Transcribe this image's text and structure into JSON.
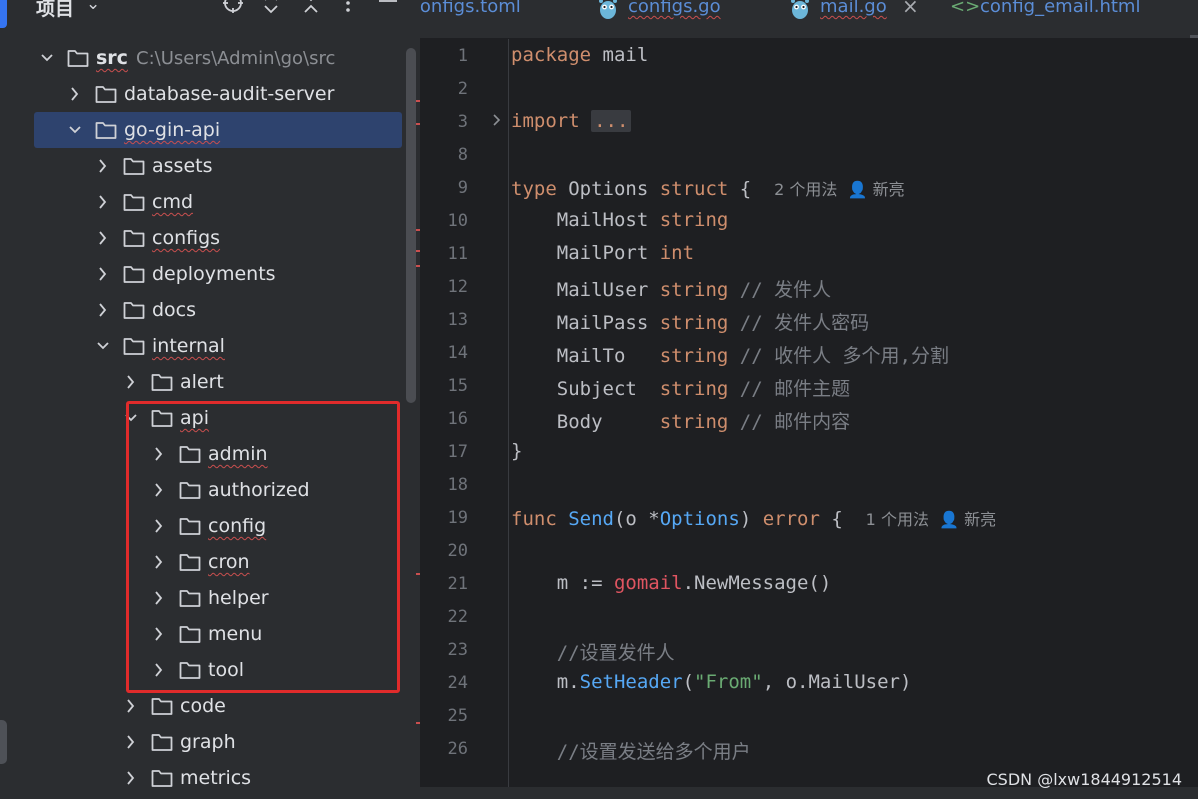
{
  "project_panel": {
    "title": "项目",
    "header_icons": [
      "locate-icon",
      "expand-all-icon",
      "collapse-all-icon",
      "more-icon",
      "minimize-icon"
    ]
  },
  "tree": {
    "rows": [
      {
        "label": "src",
        "path": "C:\\Users\\Admin\\go\\src",
        "expanded": true,
        "bold": true,
        "squiggly": true
      },
      {
        "label": "database-audit-server",
        "expanded": false
      },
      {
        "label": "go-gin-api",
        "expanded": true,
        "selected": true,
        "squiggly": true
      },
      {
        "label": "assets",
        "expanded": false
      },
      {
        "label": "cmd",
        "expanded": false,
        "squiggly": true
      },
      {
        "label": "configs",
        "expanded": false,
        "squiggly": true
      },
      {
        "label": "deployments",
        "expanded": false
      },
      {
        "label": "docs",
        "expanded": false
      },
      {
        "label": "internal",
        "expanded": true,
        "squiggly": true
      },
      {
        "label": "alert",
        "expanded": false
      },
      {
        "label": "api",
        "expanded": true,
        "squiggly": true
      },
      {
        "label": "admin",
        "expanded": false,
        "squiggly": true
      },
      {
        "label": "authorized",
        "expanded": false
      },
      {
        "label": "config",
        "expanded": false,
        "squiggly": true
      },
      {
        "label": "cron",
        "expanded": false,
        "squiggly": true
      },
      {
        "label": "helper",
        "expanded": false
      },
      {
        "label": "menu",
        "expanded": false
      },
      {
        "label": "tool",
        "expanded": false
      },
      {
        "label": "code",
        "expanded": false
      },
      {
        "label": "graph",
        "expanded": false
      },
      {
        "label": "metrics",
        "expanded": false
      }
    ]
  },
  "tabs": [
    {
      "label": "configs.toml",
      "icon": "toml-file-icon"
    },
    {
      "label": "configs.go",
      "icon": "gopher-icon",
      "squiggly": true
    },
    {
      "label": "mail.go",
      "icon": "gopher-icon",
      "active": true,
      "squiggly": true,
      "close": "×"
    },
    {
      "label": "config_email.html",
      "icon": "html-file-icon",
      "glyph": "<>"
    }
  ],
  "editor": {
    "lines": [
      {
        "n": "1",
        "tokens": [
          {
            "t": "package ",
            "c": "kw"
          },
          {
            "t": "mail",
            "c": "ident"
          }
        ]
      },
      {
        "n": "2",
        "tokens": []
      },
      {
        "n": "3",
        "fold": true,
        "tokens": [
          {
            "t": "import ",
            "c": "kw"
          },
          {
            "t": "...",
            "c": "fold-pill"
          }
        ]
      },
      {
        "n": "8",
        "tokens": []
      },
      {
        "n": "9",
        "tokens": [
          {
            "t": "type ",
            "c": "kw"
          },
          {
            "t": "Options ",
            "c": "ident"
          },
          {
            "t": "struct",
            "c": "kw"
          },
          {
            "t": " {  ",
            "c": "ident"
          },
          {
            "t": "2 个用法  ",
            "c": "hint"
          },
          {
            "t": "👤 新亮",
            "c": "hint"
          }
        ]
      },
      {
        "n": "10",
        "tokens": [
          {
            "t": "    MailHost ",
            "c": "ident"
          },
          {
            "t": "string",
            "c": "ty"
          }
        ]
      },
      {
        "n": "11",
        "tokens": [
          {
            "t": "    MailPort ",
            "c": "ident"
          },
          {
            "t": "int",
            "c": "ty"
          }
        ]
      },
      {
        "n": "12",
        "tokens": [
          {
            "t": "    MailUser ",
            "c": "ident"
          },
          {
            "t": "string",
            "c": "ty"
          },
          {
            "t": " // 发件人",
            "c": "cm"
          }
        ]
      },
      {
        "n": "13",
        "tokens": [
          {
            "t": "    MailPass ",
            "c": "ident"
          },
          {
            "t": "string",
            "c": "ty"
          },
          {
            "t": " // 发件人密码",
            "c": "cm"
          }
        ]
      },
      {
        "n": "14",
        "tokens": [
          {
            "t": "    MailTo   ",
            "c": "ident"
          },
          {
            "t": "string",
            "c": "ty"
          },
          {
            "t": " // 收件人 多个用,分割",
            "c": "cm"
          }
        ]
      },
      {
        "n": "15",
        "tokens": [
          {
            "t": "    Subject  ",
            "c": "ident"
          },
          {
            "t": "string",
            "c": "ty"
          },
          {
            "t": " // 邮件主题",
            "c": "cm"
          }
        ]
      },
      {
        "n": "16",
        "tokens": [
          {
            "t": "    Body     ",
            "c": "ident"
          },
          {
            "t": "string",
            "c": "ty"
          },
          {
            "t": " // 邮件内容",
            "c": "cm"
          }
        ]
      },
      {
        "n": "17",
        "tokens": [
          {
            "t": "}",
            "c": "ident"
          }
        ]
      },
      {
        "n": "18",
        "tokens": []
      },
      {
        "n": "19",
        "tokens": [
          {
            "t": "func ",
            "c": "kw"
          },
          {
            "t": "Send",
            "c": "fn"
          },
          {
            "t": "(o *",
            "c": "ident"
          },
          {
            "t": "Options",
            "c": "fn"
          },
          {
            "t": ") ",
            "c": "ident"
          },
          {
            "t": "error",
            "c": "ty"
          },
          {
            "t": " {  ",
            "c": "ident"
          },
          {
            "t": "1 个用法  ",
            "c": "hint"
          },
          {
            "t": "👤 新亮",
            "c": "hint"
          }
        ]
      },
      {
        "n": "20",
        "tokens": []
      },
      {
        "n": "21",
        "tokens": [
          {
            "t": "    m := ",
            "c": "ident"
          },
          {
            "t": "gomail",
            "c": "pkg"
          },
          {
            "t": ".NewMessage()",
            "c": "ident"
          }
        ]
      },
      {
        "n": "22",
        "tokens": []
      },
      {
        "n": "23",
        "tokens": [
          {
            "t": "    //设置发件人",
            "c": "cm"
          }
        ]
      },
      {
        "n": "24",
        "tokens": [
          {
            "t": "    m.",
            "c": "ident"
          },
          {
            "t": "SetHeader",
            "c": "fn"
          },
          {
            "t": "(",
            "c": "ident"
          },
          {
            "t": "\"From\"",
            "c": "str"
          },
          {
            "t": ", o.MailUser)",
            "c": "ident"
          }
        ]
      },
      {
        "n": "25",
        "tokens": []
      },
      {
        "n": "26",
        "tokens": [
          {
            "t": "    //设置发送给多个用户",
            "c": "cm"
          }
        ]
      }
    ]
  },
  "watermark": "CSDN @lxw1844912514",
  "colors": {
    "keyword": "#cf8e6d",
    "function": "#56a8f5",
    "string": "#6aab73",
    "package": "#e05561",
    "comment": "#7a7e85",
    "selection": "#2e436e",
    "highlight_box": "#e02b2b"
  }
}
